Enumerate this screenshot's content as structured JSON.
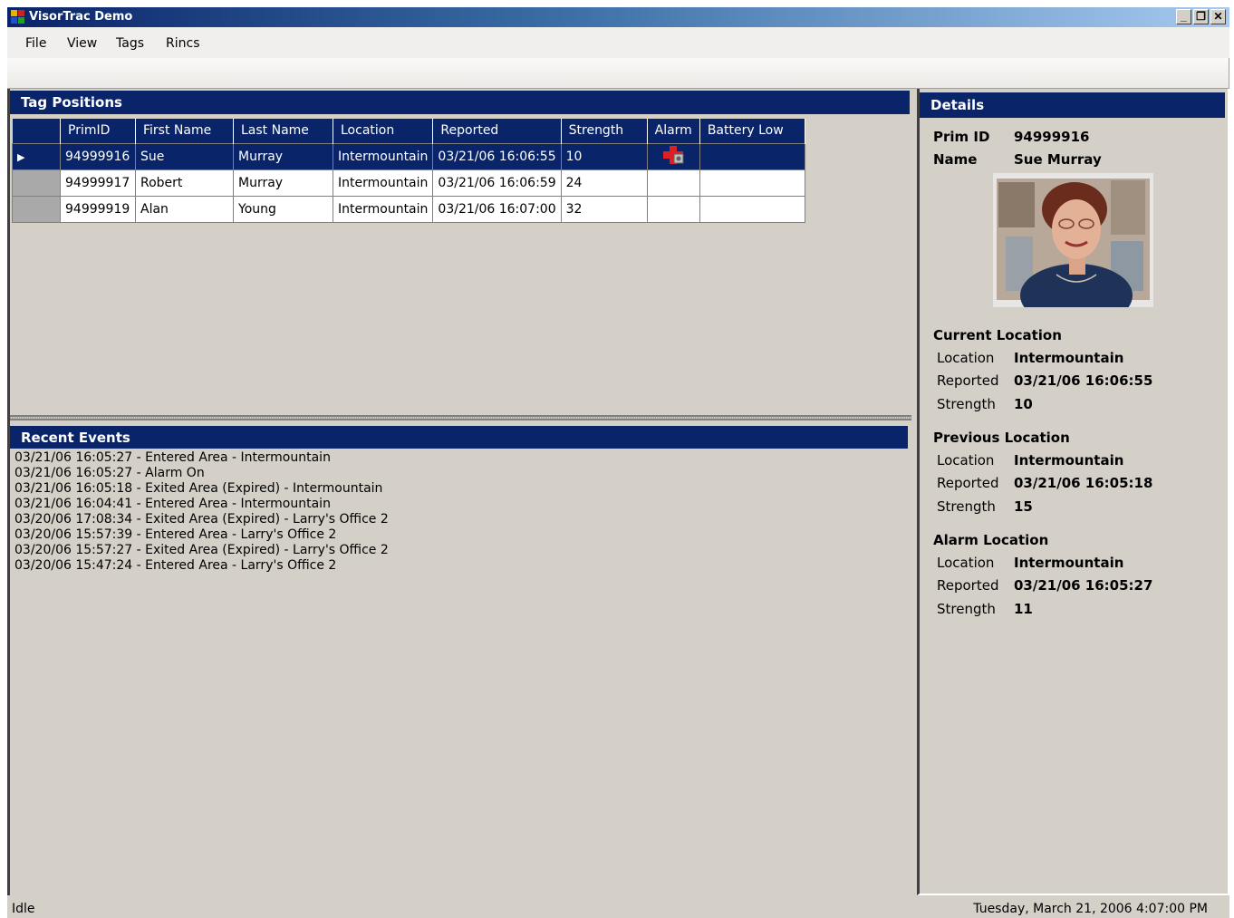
{
  "window": {
    "title": "VisorTrac Demo"
  },
  "menu": {
    "items": [
      "File",
      "View",
      "Tags",
      "Rincs"
    ]
  },
  "tag_positions": {
    "title": "Tag Positions",
    "columns": [
      "PrimID",
      "First Name",
      "Last Name",
      "Location",
      "Reported",
      "Strength",
      "Alarm",
      "Battery Low"
    ],
    "rows": [
      {
        "primid": "94999916",
        "first": "Sue",
        "last": "Murray",
        "location": "Intermountain",
        "reported": "03/21/06 16:06:55",
        "strength": "10",
        "alarm": true,
        "selected": true
      },
      {
        "primid": "94999917",
        "first": "Robert",
        "last": "Murray",
        "location": "Intermountain",
        "reported": "03/21/06 16:06:59",
        "strength": "24",
        "alarm": false,
        "selected": false
      },
      {
        "primid": "94999919",
        "first": "Alan",
        "last": "Young",
        "location": "Intermountain",
        "reported": "03/21/06 16:07:00",
        "strength": "32",
        "alarm": false,
        "selected": false
      }
    ]
  },
  "recent_events": {
    "title": "Recent Events",
    "items": [
      "03/21/06 16:05:27 - Entered Area - Intermountain",
      "03/21/06 16:05:27 - Alarm On",
      "03/21/06 16:05:18 - Exited Area (Expired) - Intermountain",
      "03/21/06 16:04:41 - Entered Area - Intermountain",
      "03/20/06 17:08:34 - Exited Area (Expired) - Larry's Office 2",
      "03/20/06 15:57:39 - Entered Area - Larry's Office 2",
      "03/20/06 15:57:27 - Exited Area (Expired) - Larry's Office 2",
      "03/20/06 15:47:24 - Entered Area - Larry's Office 2"
    ]
  },
  "details": {
    "title": "Details",
    "prim_id_label": "Prim ID",
    "prim_id": "94999916",
    "name_label": "Name",
    "name": "Sue Murray",
    "location_label": "Location",
    "reported_label": "Reported",
    "strength_label": "Strength",
    "current": {
      "heading": "Current Location",
      "location": "Intermountain",
      "reported": "03/21/06 16:06:55",
      "strength": "10"
    },
    "previous": {
      "heading": "Previous Location",
      "location": "Intermountain",
      "reported": "03/21/06 16:05:18",
      "strength": "15"
    },
    "alarm": {
      "heading": "Alarm Location",
      "location": "Intermountain",
      "reported": "03/21/06 16:05:27",
      "strength": "11"
    }
  },
  "status": {
    "left": "Idle",
    "right": "Tuesday, March 21, 2006 4:07:00 PM"
  },
  "colors": {
    "header_blue": "#0a246a",
    "face": "#d4d0c8",
    "alarm_red": "#e02020"
  },
  "icons": {
    "app": "app-icon",
    "alarm": "alarm-cross-icon",
    "row_pointer": "row-pointer-icon"
  }
}
